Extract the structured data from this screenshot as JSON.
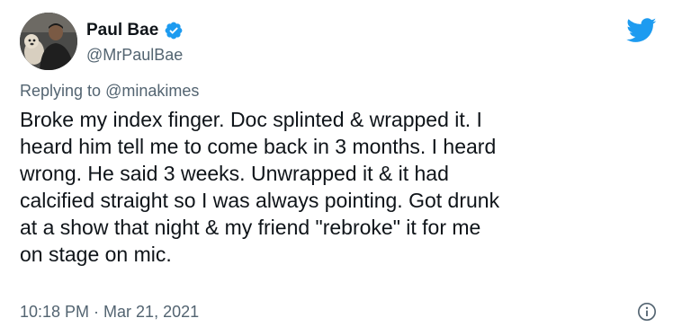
{
  "author": {
    "display_name": "Paul Bae",
    "handle": "@MrPaulBae",
    "verified": true,
    "avatar_icon": "avatar-photo"
  },
  "reply": {
    "prefix": "Replying to ",
    "mention": "@minakimes"
  },
  "tweet": {
    "lines": [
      "Broke my index finger. Doc splinted & wrapped it. I",
      "heard him tell me to come back in 3 months. I heard",
      "wrong. He said 3 weeks. Unwrapped it & it had",
      "calcified straight so I was always pointing. Got drunk",
      "at a show that night & my friend \"rebroke\" it for me",
      "on stage on mic."
    ]
  },
  "meta": {
    "time": "10:18 PM",
    "separator": "·",
    "date": "Mar 21, 2021"
  },
  "icons": {
    "brand": "twitter-bird-icon",
    "verified": "verified-badge-icon",
    "info": "info-icon"
  },
  "colors": {
    "brand_blue": "#1d9bf0",
    "text_primary": "#0f1419",
    "text_secondary": "#536471"
  }
}
